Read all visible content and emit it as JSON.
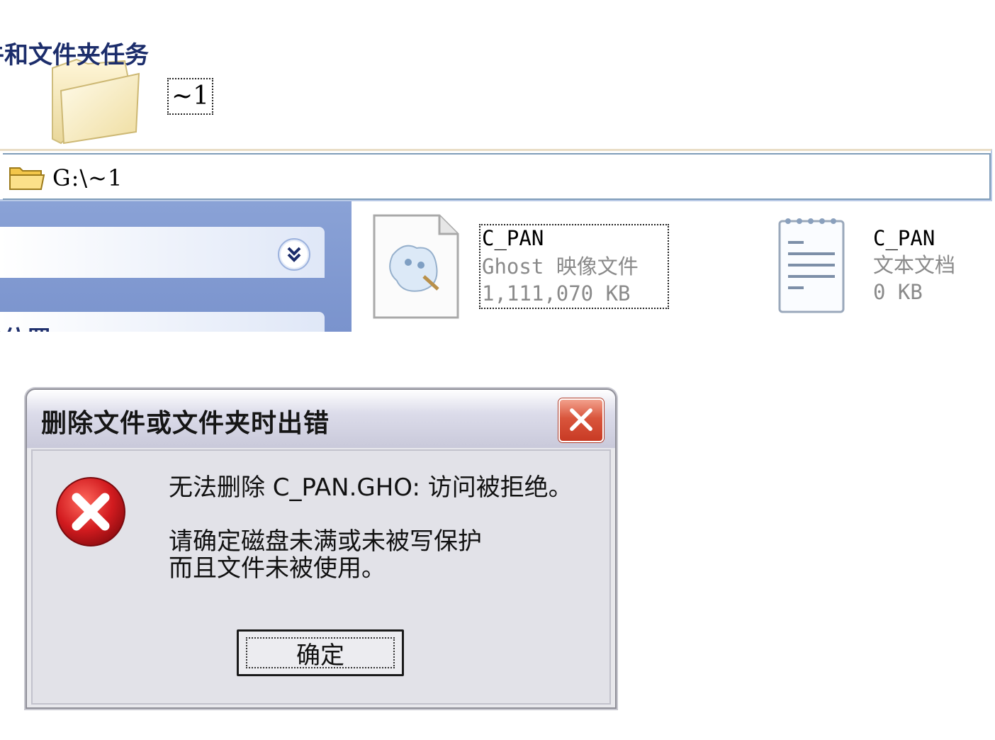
{
  "folder": {
    "name": "~1"
  },
  "address_bar": {
    "path": "G:\\~1"
  },
  "task_pane": {
    "sections": [
      {
        "title": "牛和文件夹任务",
        "icon": "chevron-double-down-icon"
      },
      {
        "title": "他位置",
        "icon": "chevron-double-up-icon"
      }
    ]
  },
  "files": [
    {
      "name": "C_PAN",
      "type": "Ghost 映像文件",
      "size": "1,111,070 KB",
      "icon": "ghost-image-icon",
      "selected": true
    },
    {
      "name": "C_PAN",
      "type": "文本文档",
      "size": "0 KB",
      "icon": "notepad-text-icon",
      "selected": false
    }
  ],
  "dialog": {
    "title": "删除文件或文件夹时出错",
    "message_line1": "无法删除 C_PAN.GHO: 访问被拒绝。",
    "message_line2": "请确定磁盘未满或未被写保护",
    "message_line3": "而且文件未被使用。",
    "ok_label": "确定",
    "icon": "error-icon",
    "close_icon": "close-icon"
  },
  "colors": {
    "task_pane_blue": "#7a93cd",
    "close_red": "#d9553c",
    "error_red": "#c8161d"
  }
}
